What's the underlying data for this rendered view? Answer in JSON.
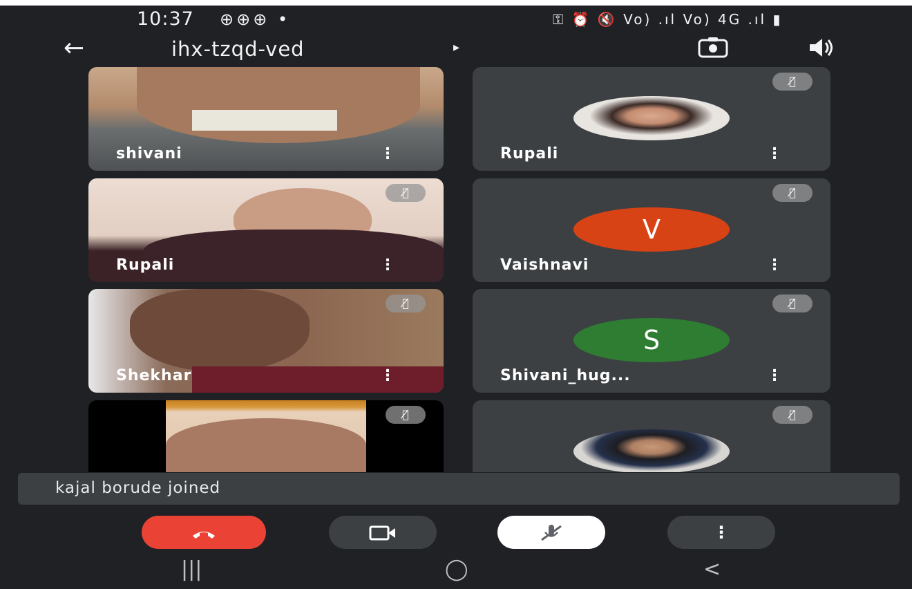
{
  "status_bar": {
    "time": "10:37",
    "left_icons": "⊕⊕⊕ •",
    "right_icons": "⚿ ⏰ 🔇 Vo) .ıl Vo) 4G .ıl ▮"
  },
  "toolbar": {
    "meeting_code": "ihx-tzqd-ved",
    "back_icon": "arrow-left-icon",
    "switch_camera_icon": "switch-camera-icon",
    "speaker_icon": "speaker-icon"
  },
  "tiles": [
    {
      "name": "shivani",
      "type": "video",
      "muted": false
    },
    {
      "name": "Rupali",
      "type": "avatar-photo",
      "muted": true
    },
    {
      "name": "Rupali",
      "type": "video",
      "muted": true
    },
    {
      "name": "Vaishnavi",
      "type": "avatar-letter",
      "letter": "V",
      "avatar_color": "#d84315",
      "muted": true
    },
    {
      "name": "Shekhar",
      "type": "video",
      "muted": true
    },
    {
      "name": "Shivani_hug...",
      "type": "avatar-letter",
      "letter": "S",
      "avatar_color": "#2e7d32",
      "muted": true
    },
    {
      "name": "",
      "type": "video",
      "muted": true
    },
    {
      "name": "",
      "type": "avatar-photo",
      "muted": true
    }
  ],
  "more_glyph": "⋮",
  "mute_glyph": "🎙̸",
  "toast": {
    "text": "kajal borude joined"
  },
  "controls": {
    "end_call_icon": "phone-hangup-icon",
    "camera_icon": "video-camera-icon",
    "mic_icon": "mic-off-icon",
    "more_icon": "more-vert-icon",
    "end_call_color": "#ea4335"
  },
  "nav": {
    "recents": "|||",
    "home": "◯",
    "back": "<"
  }
}
